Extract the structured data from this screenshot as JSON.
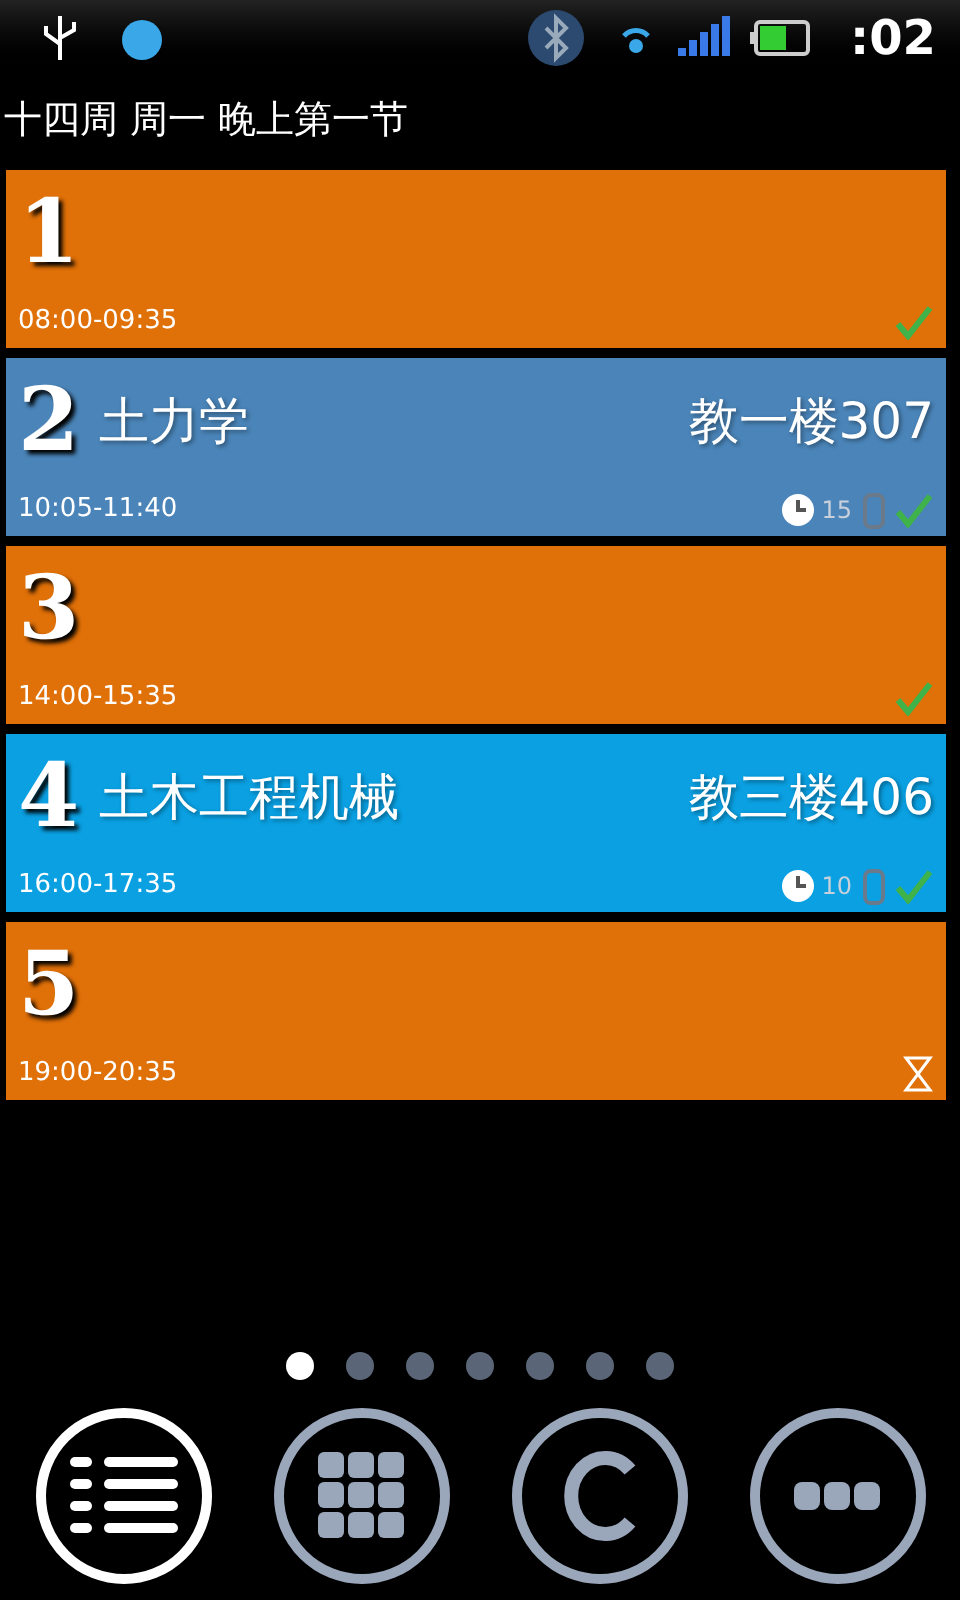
{
  "status_bar": {
    "time": ":02"
  },
  "title": "十四周 周一 晚上第一节",
  "periods": [
    {
      "number": "1",
      "time": "08:00-09:35",
      "color": "#e07008",
      "finished": true,
      "silent": false
    },
    {
      "number": "2",
      "course": "土力学",
      "room": "教一楼307",
      "time": "10:05-11:40",
      "color": "#4a84b8",
      "alarm": "15",
      "silent": true,
      "finished": true
    },
    {
      "number": "3",
      "time": "14:00-15:35",
      "color": "#e07008",
      "finished": true,
      "silent": false
    },
    {
      "number": "4",
      "course": "土木工程机械",
      "room": "教三楼406",
      "time": "16:00-17:35",
      "color": "#0aa0e2",
      "alarm": "10",
      "silent": true,
      "finished": true
    },
    {
      "number": "5",
      "time": "19:00-20:35",
      "color": "#e07008",
      "finished": false,
      "silent": false
    }
  ],
  "pages": [
    {
      "selected": true
    },
    {
      "selected": false
    },
    {
      "selected": false
    },
    {
      "selected": false
    },
    {
      "selected": false
    },
    {
      "selected": false
    },
    {
      "selected": false
    }
  ],
  "nav": [
    {
      "kind": "list",
      "selected": true
    },
    {
      "kind": "grid",
      "selected": false
    },
    {
      "kind": "copyright",
      "selected": false
    },
    {
      "kind": "more",
      "selected": false
    }
  ]
}
